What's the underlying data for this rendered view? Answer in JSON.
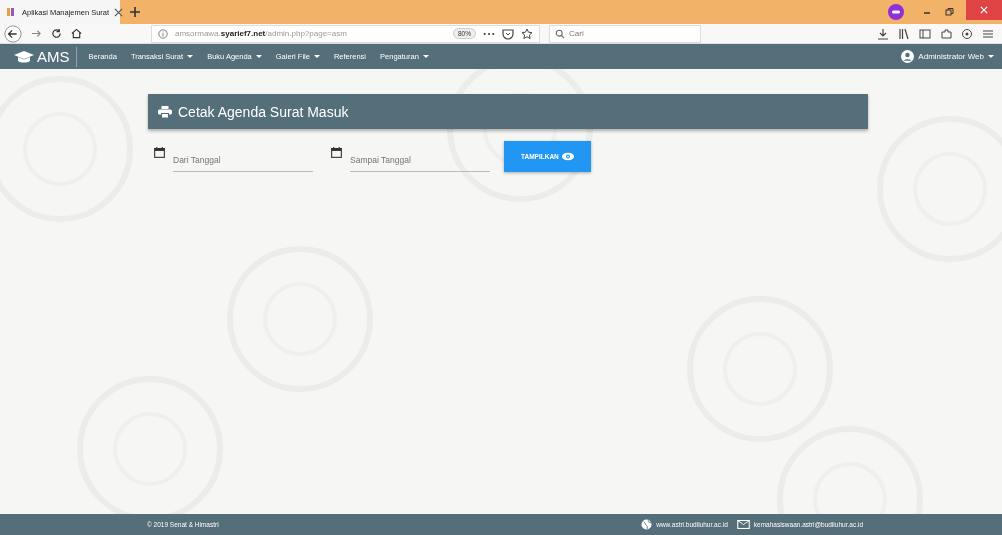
{
  "browser": {
    "tab": {
      "title": "Aplikasi Manajemen Surat",
      "selected": true
    },
    "url": "amsormawa.**syarief7.net**/admin.php?page=asm",
    "zoom": "80%",
    "search": {
      "placeholder": "Cari"
    }
  },
  "navbar": {
    "brand": "AMS",
    "items": [
      {
        "label": "Beranda",
        "dropdown": false
      },
      {
        "label": "Transaksi Surat",
        "dropdown": true
      },
      {
        "label": "Buku Agenda",
        "dropdown": true
      },
      {
        "label": "Galeri File",
        "dropdown": true
      },
      {
        "label": "Referensi",
        "dropdown": false
      },
      {
        "label": "Pengaturan",
        "dropdown": true
      }
    ],
    "user": {
      "label": "Administrator Web",
      "dropdown": true
    }
  },
  "panel": {
    "title": "Cetak Agenda Surat Masuk"
  },
  "form": {
    "fields": [
      {
        "placeholder": "Dari Tanggal"
      },
      {
        "placeholder": "Sampai Tanggal"
      }
    ],
    "button": "TAMPILKAN"
  },
  "footer": {
    "copyright": "© 2019 Senat & Himastri",
    "website": "www.astri.budiluhur.ac.id",
    "email": "kemahasiswaan.astri@budiluhur.ac.id"
  }
}
